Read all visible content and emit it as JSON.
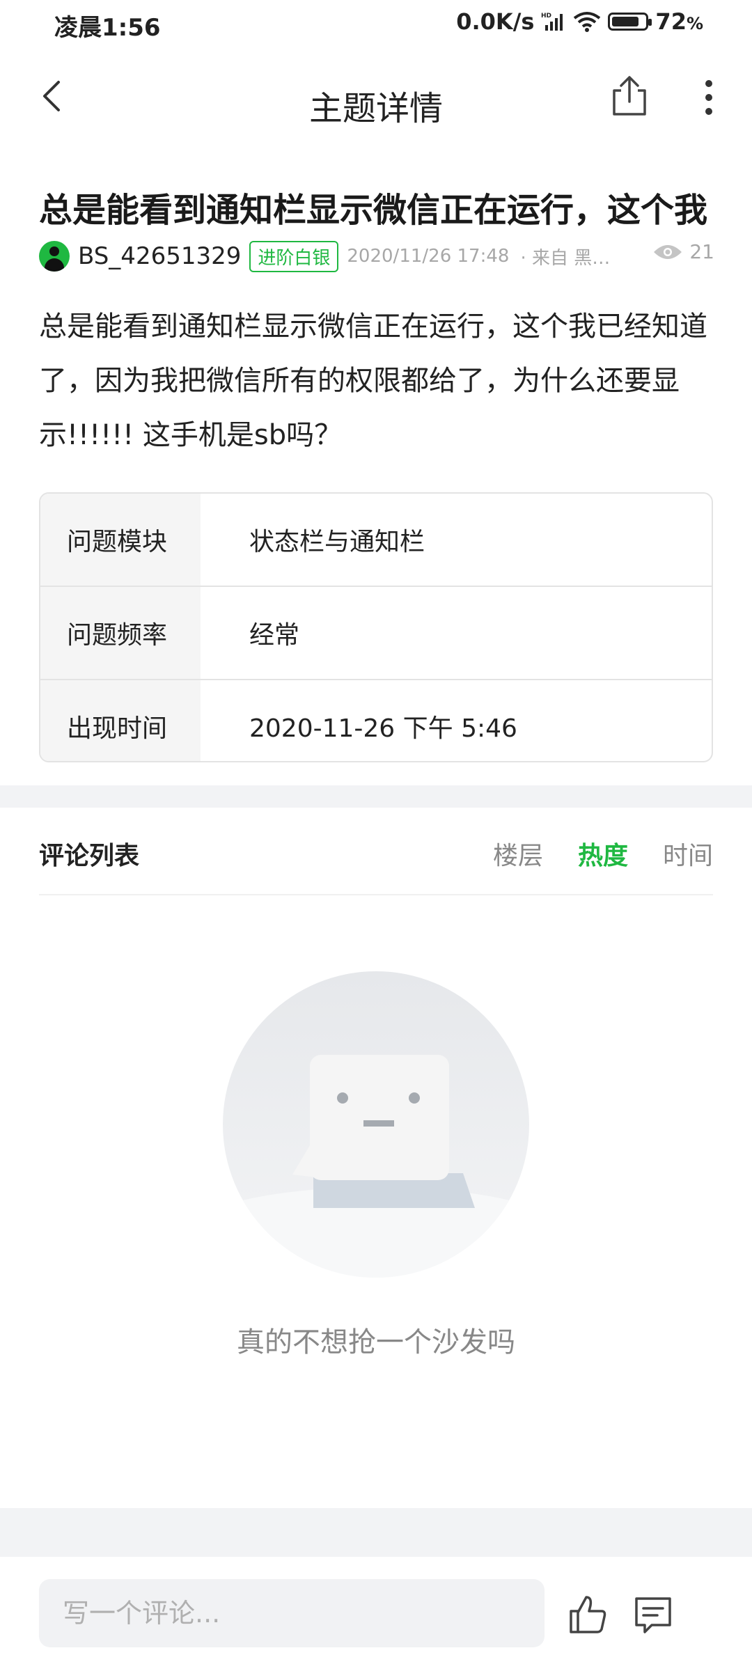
{
  "status_bar": {
    "time": "凌晨1:56",
    "network_speed": "0.0K/s",
    "battery": "72",
    "battery_unit": "%",
    "icons": [
      "hd-signal-icon",
      "wifi-icon",
      "battery-icon"
    ]
  },
  "nav": {
    "title": "主题详情",
    "back_icon": "chevron-left-icon",
    "share_icon": "share-icon",
    "more_icon": "more-vertical-icon"
  },
  "post": {
    "title": "总是能看到通知栏显示微信正在运行，这个我",
    "author": "BS_42651329",
    "badge": "进阶白银",
    "datetime": "2020/11/26 17:48",
    "source": "· 来自 黑鲨...",
    "views": "21",
    "body": "总是能看到通知栏显示微信正在运行，这个我已经知道了，因为我把微信所有的权限都给了，为什么还要显示!!!!!! 这手机是sb吗？"
  },
  "info_table": [
    {
      "label": "问题模块",
      "value": "状态栏与通知栏"
    },
    {
      "label": "问题频率",
      "value": "经常"
    },
    {
      "label": "出现时间",
      "value": "2020-11-26 下午 5:46"
    }
  ],
  "comments": {
    "title": "评论列表",
    "sorts": [
      "楼层",
      "热度",
      "时间"
    ],
    "active_sort": "热度",
    "empty_text": "真的不想抢一个沙发吗"
  },
  "bottom_bar": {
    "input_placeholder": "写一个评论...",
    "like_icon": "thumbs-up-icon",
    "comment_icon": "comment-icon"
  },
  "colors": {
    "accent": "#1fb841",
    "muted": "#a7a7a7",
    "divider": "#f2f3f5"
  }
}
